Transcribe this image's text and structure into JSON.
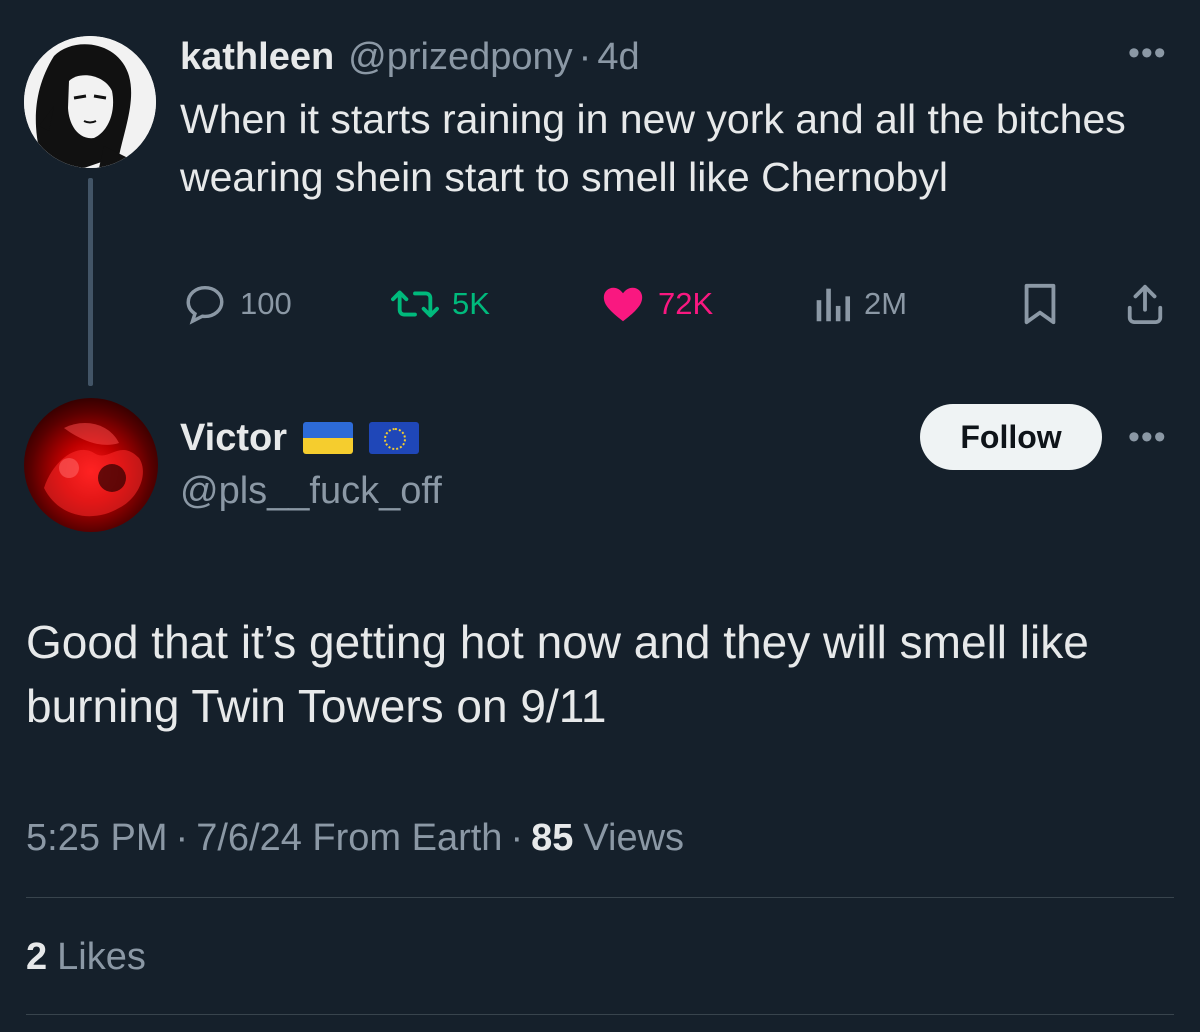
{
  "colors": {
    "background": "#15202b",
    "text_primary": "#e7e9ea",
    "text_secondary": "#8b98a5",
    "retweet_green": "#00ba7c",
    "like_pink": "#f91880",
    "divider": "#38444d"
  },
  "parent_tweet": {
    "display_name": "kathleen",
    "handle": "@prizedpony",
    "separator": "·",
    "age": "4d",
    "text": "When it starts raining in new york and all the bitches wearing shein start to smell like Chernobyl",
    "more_icon": "more-horizontal-icon",
    "actions": {
      "replies": "100",
      "retweets": "5K",
      "likes": "72K",
      "views": "2M"
    }
  },
  "reply_tweet": {
    "display_name": "Victor",
    "flags": [
      "ukraine-flag-icon",
      "eu-flag-icon"
    ],
    "handle": "@pls__fuck_off",
    "follow_label": "Follow",
    "more_icon": "more-horizontal-icon",
    "text": "Good that it’s getting hot now and they will smell like burning Twin Towers on 9/11",
    "time": "5:25 PM",
    "separator": "·",
    "date": "7/6/24 From Earth",
    "views_count": "85",
    "views_label": "Views",
    "likes_count": "2",
    "likes_label": "Likes"
  }
}
